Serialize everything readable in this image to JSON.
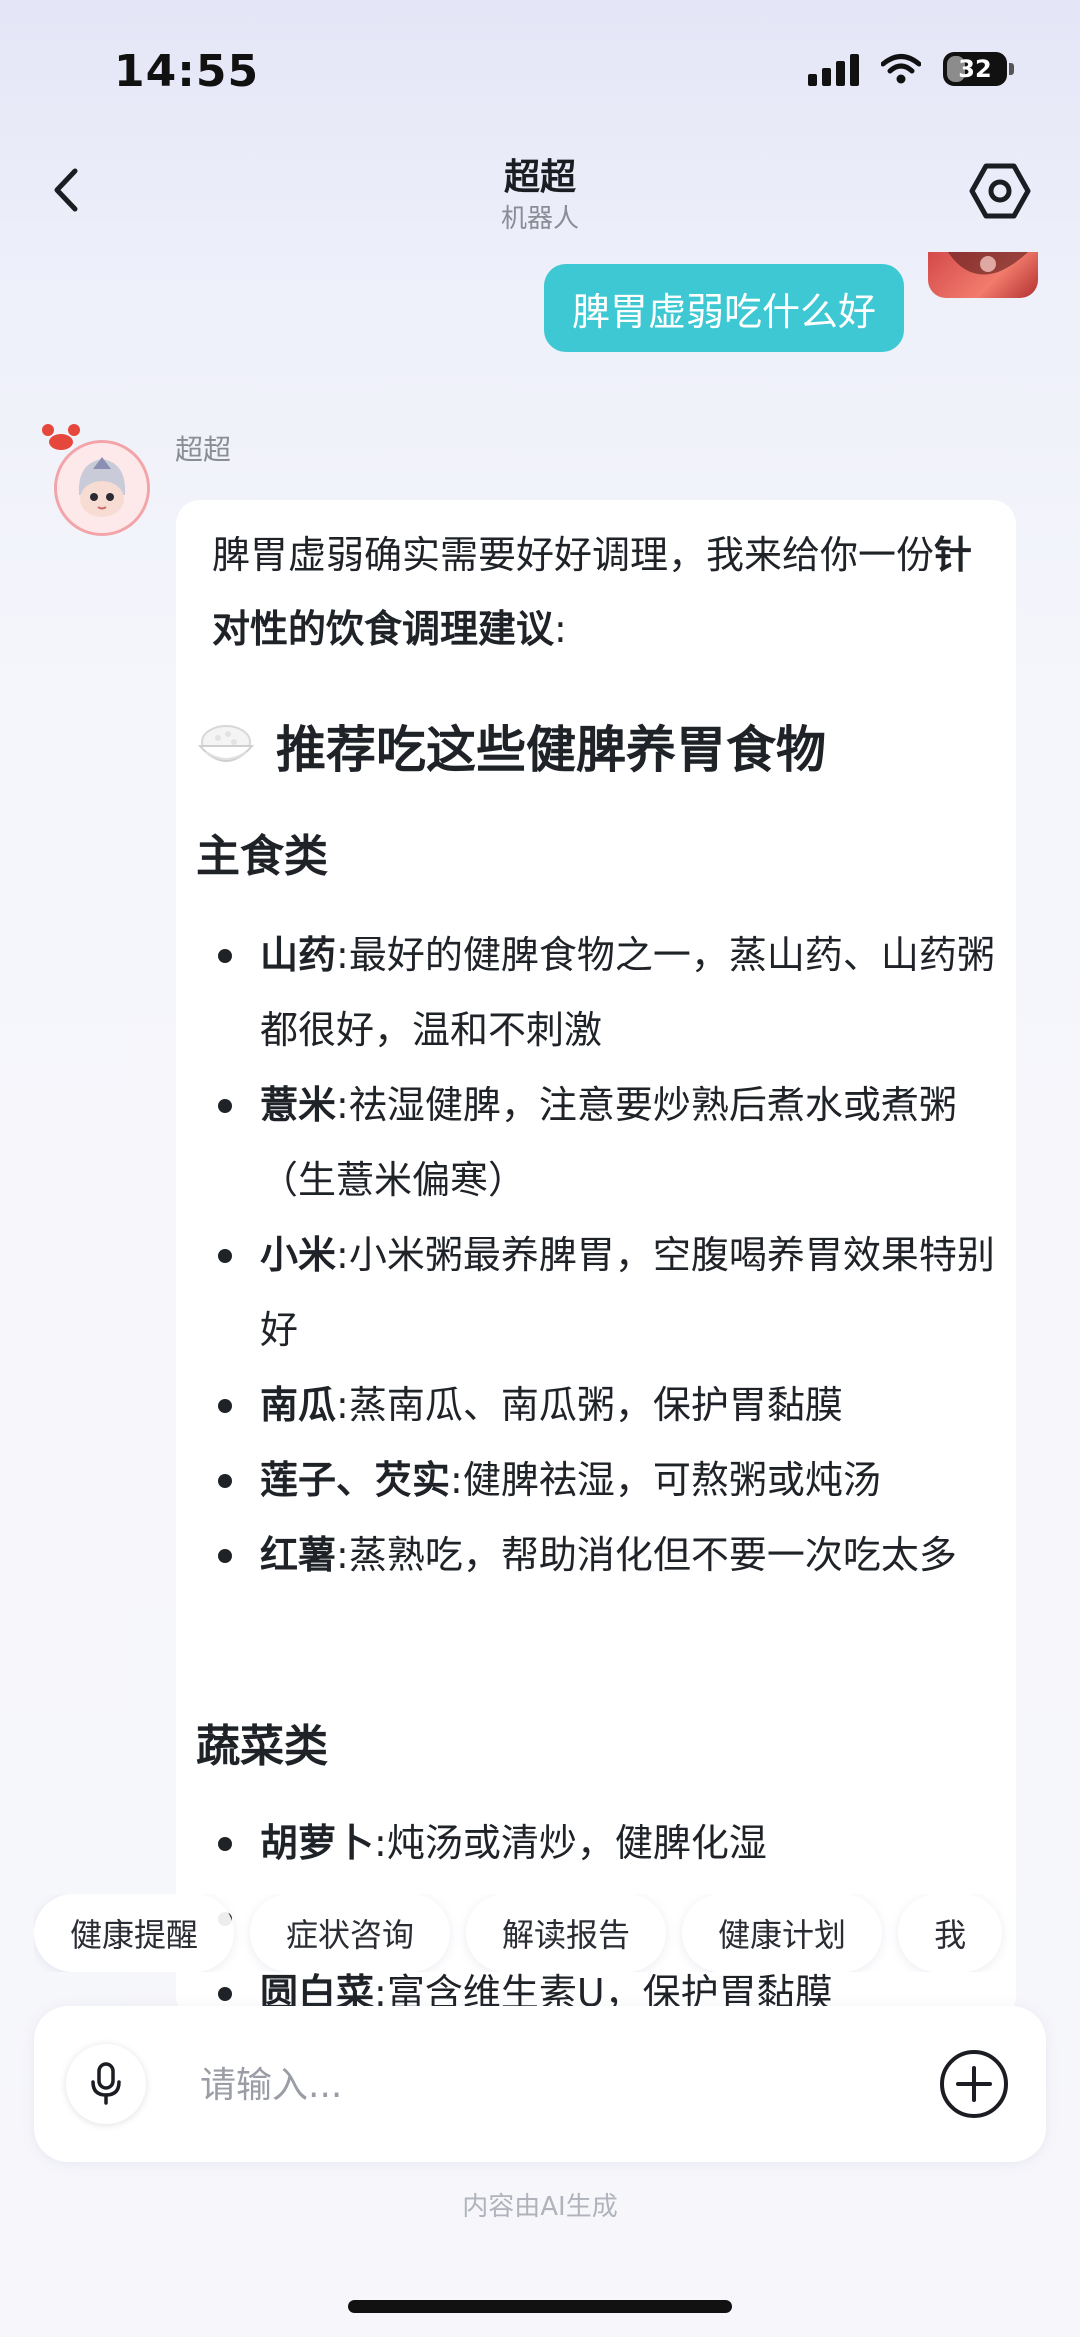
{
  "status_bar": {
    "time": "14:55",
    "battery": "32",
    "battery_level": 0.32
  },
  "header": {
    "title": "超超",
    "subtitle": "机器人"
  },
  "user_message": {
    "text": "脾胃虚弱吃什么好"
  },
  "bot": {
    "name": "超超",
    "intro_prefix": "脾胃虚弱确实需要好好调理，我来给你一份",
    "intro_bold": "针对性的饮食调理建议",
    "intro_suffix": ":",
    "section_title": "推荐吃这些健脾养胃食物",
    "subsections": [
      {
        "title": "主食类",
        "items": [
          {
            "name": "山药",
            "desc": ":最好的健脾食物之一，蒸山药、山药粥都很好，温和不刺激"
          },
          {
            "name": "薏米",
            "desc": ":祛湿健脾，注意要炒熟后煮水或煮粥（生薏米偏寒）"
          },
          {
            "name": "小米",
            "desc": ":小米粥最养脾胃，空腹喝养胃效果特别好"
          },
          {
            "name": "南瓜",
            "desc": ":蒸南瓜、南瓜粥，保护胃黏膜"
          },
          {
            "name": "莲子、芡实",
            "desc": ":健脾祛湿，可熬粥或炖汤"
          },
          {
            "name": "红薯",
            "desc": ":蒸熟吃，帮助消化但不要一次吃太多"
          }
        ]
      },
      {
        "title": "蔬菜类",
        "items": [
          {
            "name": "胡萝卜",
            "desc": ":炖汤或清炒，健脾化湿"
          },
          {
            "name": "",
            "desc": ""
          },
          {
            "name": "圆白菜",
            "desc": ":富含维生素U，保护胃黏膜"
          }
        ]
      }
    ]
  },
  "quick_actions": [
    "健康提醒",
    "症状咨询",
    "解读报告",
    "健康计划",
    "我"
  ],
  "input": {
    "placeholder": "请输入..."
  },
  "footer": {
    "disclaimer": "内容由AI生成"
  },
  "icons": {
    "back": "chevron-left-icon",
    "settings": "hexagon-gear-icon",
    "mic": "microphone-icon",
    "add": "plus-circle-icon",
    "rice": "rice-bowl-icon"
  }
}
